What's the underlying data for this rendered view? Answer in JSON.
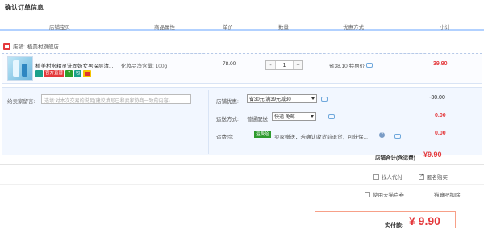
{
  "page": {
    "title": "确认订单信息"
  },
  "table_header": {
    "columns": [
      "店铺宝贝",
      "商品属性",
      "单价",
      "数量",
      "优惠方式",
      "小计"
    ]
  },
  "shop": {
    "label": "店铺:",
    "name": "植美村旗舰店"
  },
  "item": {
    "title": "植美村水精灵洗面奶女男深层清...",
    "attribute": "化妆品净含量: 100g",
    "badges": {
      "official": "官方直营",
      "tag_green": "7",
      "tag_teal": "包"
    },
    "price": "78.00",
    "qty": {
      "minus": "-",
      "value": "1",
      "plus": "+"
    },
    "promo": "省38.10:特惠价",
    "subtotal": "39.90"
  },
  "options": {
    "message_label": "给卖家留言:",
    "message_placeholder": "选填:对本次交易的说明(建议填写已和卖家协商一致的内容)",
    "shop_discount_label": "店铺优惠:",
    "shop_discount_value": "省30元:满39元减30",
    "shop_discount_amount": "-30.00",
    "shipping_label": "运送方式:",
    "shipping_type": "普通配送",
    "shipping_value": "快递 免邮",
    "shipping_amount": "0.00",
    "insurance_label": "运费险:",
    "insurance_tag": "运费险",
    "insurance_text": "卖家赠送，若确认收货前退货，可获保...",
    "insurance_amount": "0.00",
    "shop_total_label": "店铺合计(含运费)",
    "shop_total_value": "¥9.90"
  },
  "checkout": {
    "proxy_pay": "找人代付",
    "anonymous": "匿名购买",
    "tmall_points": "使用天猫点券",
    "tmall_points_link": "猫算吧扣除",
    "pay_label": "实付款:",
    "pay_value": "¥ 9.90"
  },
  "colors": {
    "accent": "#e4393c",
    "header_border": "#b2d1ff",
    "panel": "#f2f7ff"
  }
}
